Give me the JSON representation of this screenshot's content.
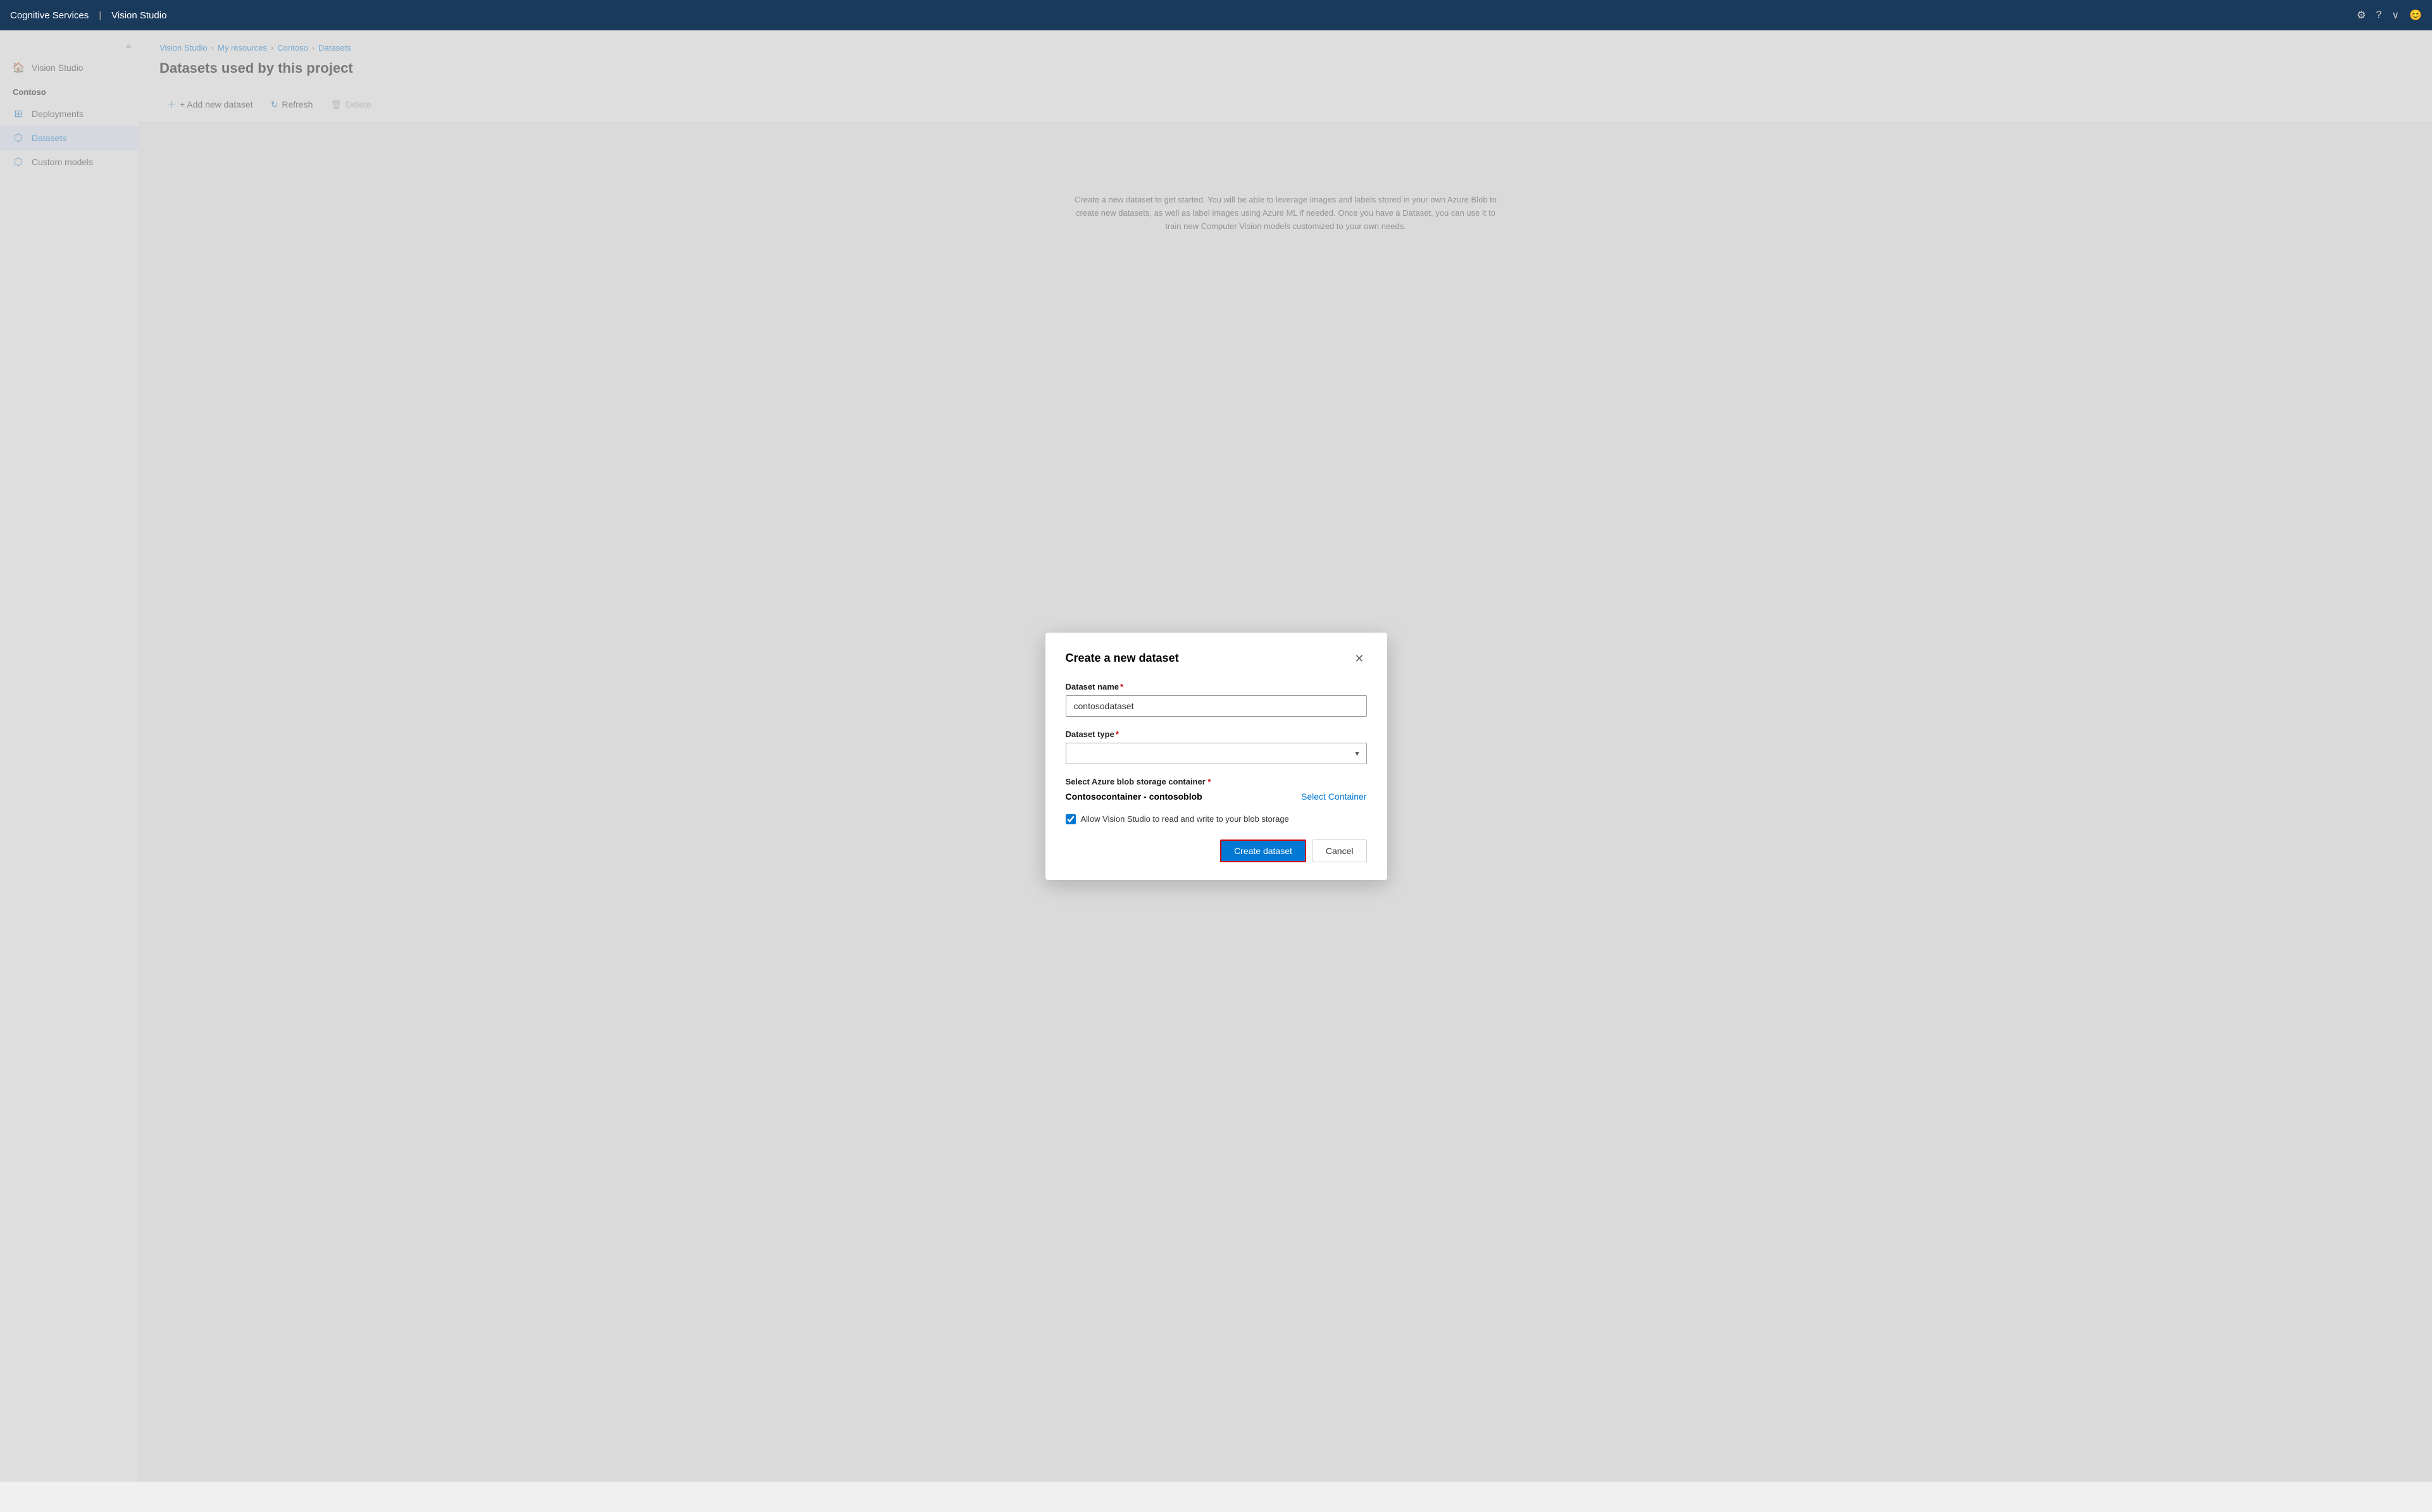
{
  "topnav": {
    "brand": "Cognitive Services",
    "divider": "|",
    "app": "Vision Studio"
  },
  "sidebar": {
    "collapse_label": "«",
    "section_title": "Contoso",
    "items": [
      {
        "id": "vision-studio",
        "label": "Vision Studio",
        "icon": "🏠"
      },
      {
        "id": "deployments",
        "label": "Deployments",
        "icon": "⊞"
      },
      {
        "id": "datasets",
        "label": "Datasets",
        "icon": "⬡",
        "active": true
      },
      {
        "id": "custom-models",
        "label": "Custom models",
        "icon": "⬡"
      }
    ]
  },
  "breadcrumb": {
    "items": [
      "Vision Studio",
      "My resources",
      "Contoso",
      "Datasets"
    ],
    "separators": [
      ">",
      ">",
      ">"
    ]
  },
  "page": {
    "title": "Datasets used by this project"
  },
  "toolbar": {
    "add_label": "+ Add new dataset",
    "refresh_label": "Refresh",
    "delete_label": "Delete"
  },
  "bg_description": "Create a new dataset to get started. You will be able to leverage images and labels stored in your own Azure Blob to create new datasets, as well as label images using Azure ML if needed. Once you have a Dataset, you can use it to train new Computer Vision models customized to your own needs.",
  "modal": {
    "title": "Create a new dataset",
    "close_label": "✕",
    "dataset_name_label": "Dataset name",
    "dataset_name_value": "contosodataset",
    "dataset_name_placeholder": "contosodataset",
    "dataset_type_label": "Dataset type",
    "dataset_type_placeholder": "",
    "storage_label": "Select Azure blob storage container",
    "storage_name": "Contosocontainer - contosoblob",
    "select_container_label": "Select Container",
    "checkbox_label": "Allow Vision Studio to read and write to your blob storage",
    "checkbox_checked": true,
    "create_button_label": "Create dataset",
    "cancel_button_label": "Cancel"
  }
}
